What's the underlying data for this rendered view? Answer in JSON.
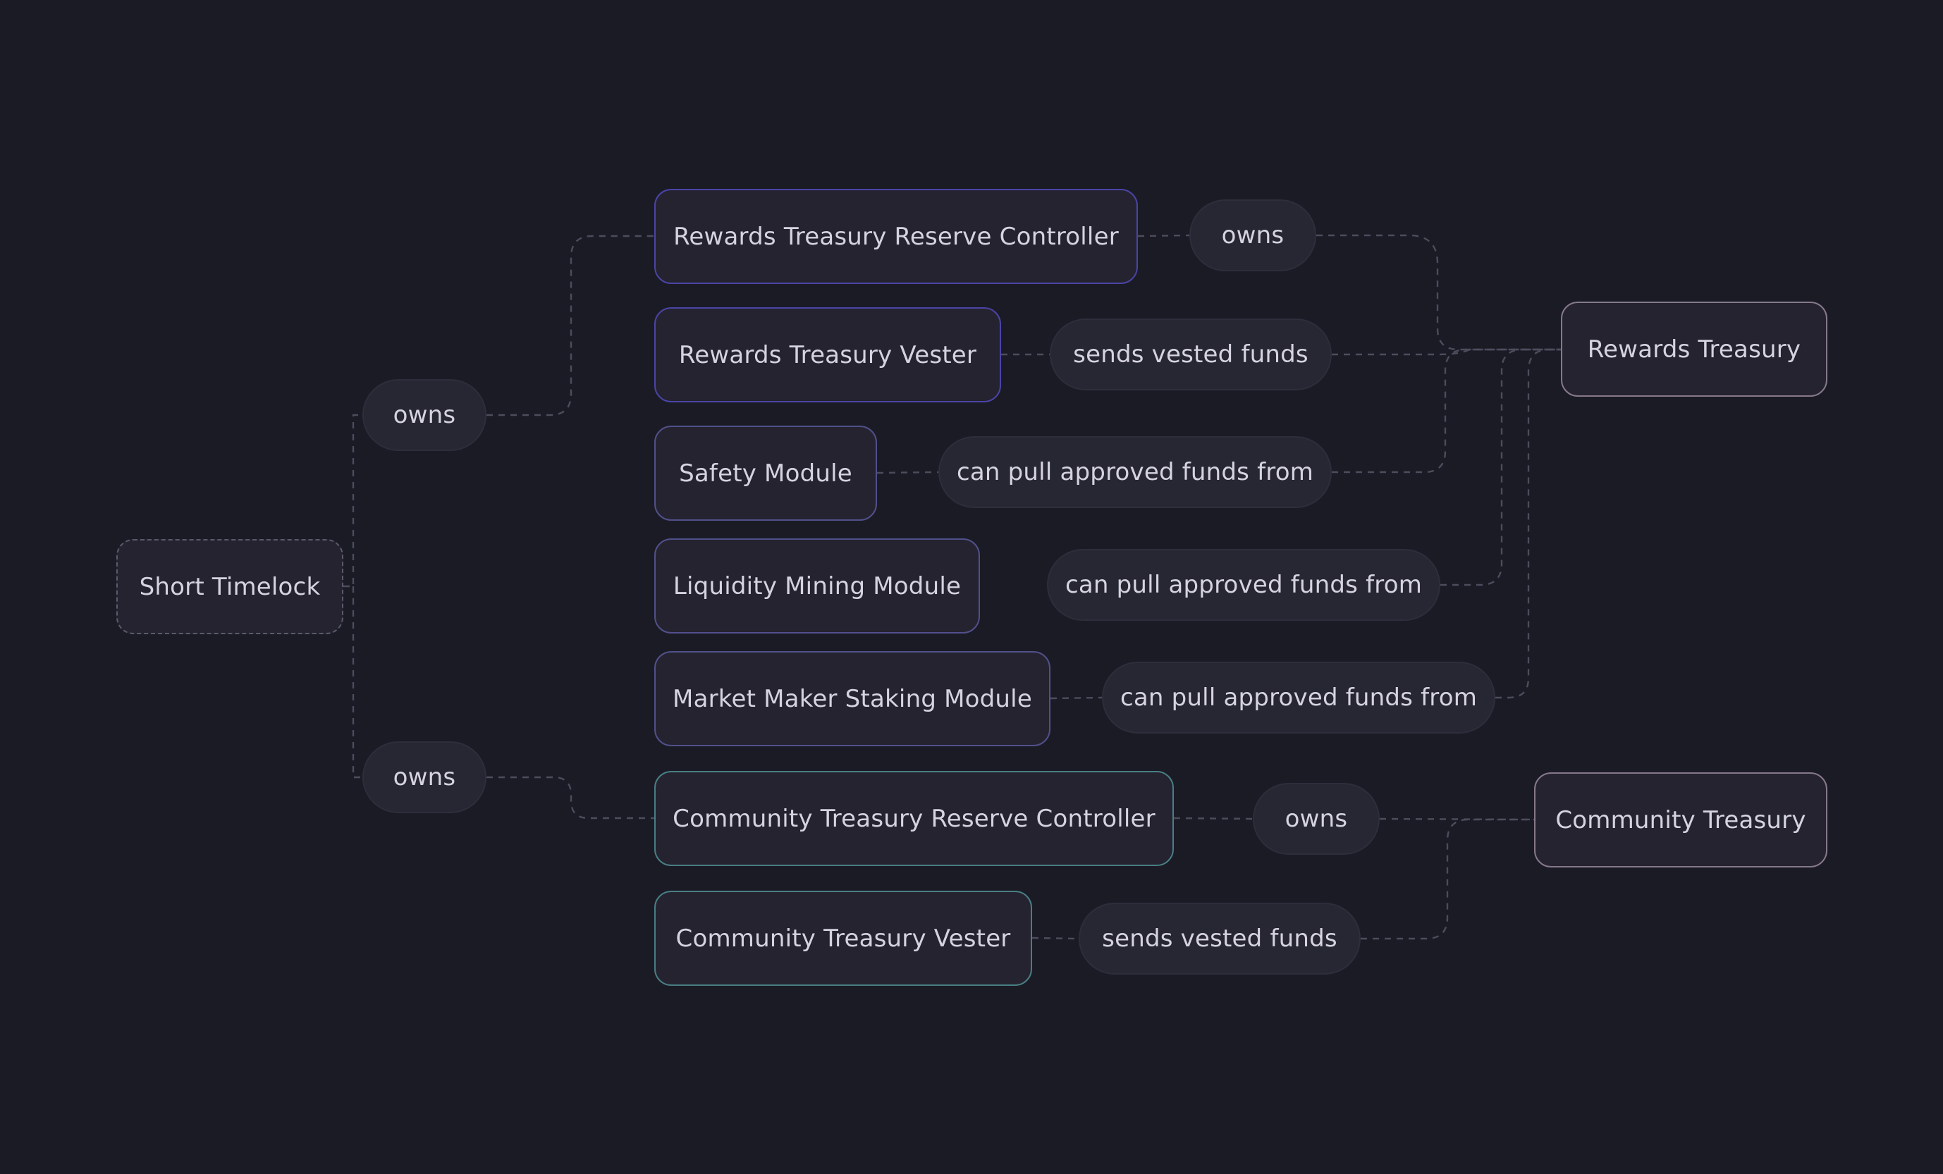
{
  "nodes": {
    "short_timelock": "Short Timelock",
    "owns_top": "owns",
    "owns_bottom": "owns",
    "rewards_treasury_reserve_controller": "Rewards Treasury Reserve Controller",
    "rewards_treasury_vester": "Rewards Treasury Vester",
    "safety_module": "Safety Module",
    "liquidity_mining_module": "Liquidity Mining Module",
    "market_maker_staking_module": "Market Maker Staking Module",
    "community_treasury_reserve_controller": "Community Treasury Reserve Controller",
    "community_treasury_vester": "Community Treasury Vester",
    "owns_rewards_reserve": "owns",
    "sends_vested_funds_rewards": "sends vested funds",
    "can_pull_safety": "can pull approved funds from",
    "can_pull_liquidity": "can pull approved funds from",
    "can_pull_market_maker": "can pull approved funds from",
    "owns_community_reserve": "owns",
    "sends_vested_funds_community": "sends vested funds",
    "rewards_treasury": "Rewards Treasury",
    "community_treasury": "Community Treasury"
  },
  "colors": {
    "background": "#1b1b26",
    "node_fill": "#24232f",
    "text": "#d5d3e0",
    "edge": "#4c4c5c",
    "rewards_border": "#4b44a6",
    "module_border": "#51508a",
    "community_border": "#487e84",
    "treasury_border": "#86788a"
  }
}
